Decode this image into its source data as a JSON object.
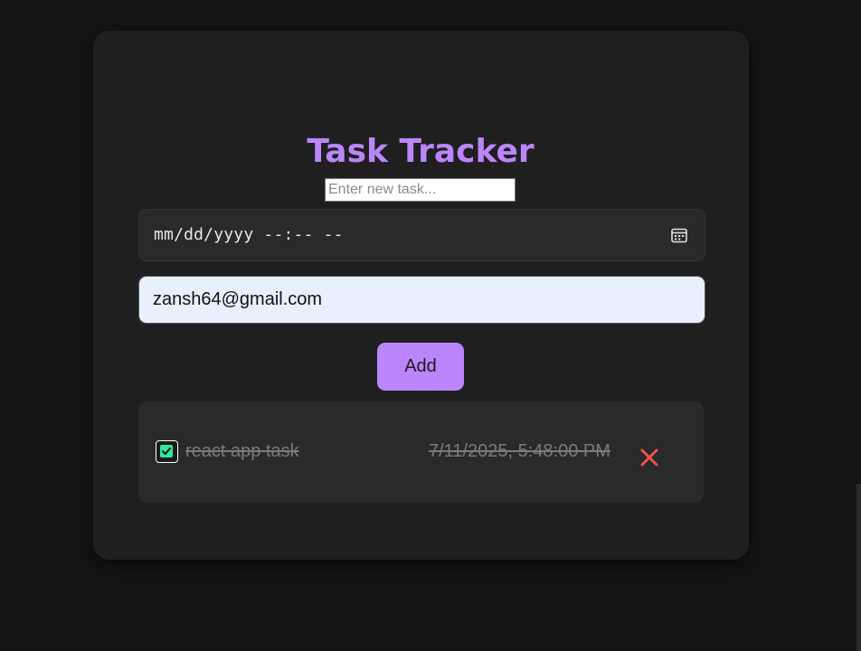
{
  "app": {
    "title": "Task Tracker"
  },
  "form": {
    "task_input": {
      "value": "",
      "placeholder": "Enter new task..."
    },
    "datetime_input": {
      "placeholder": "mm/dd/yyyy --:-- --"
    },
    "email_input": {
      "value": "zansh64@gmail.com"
    },
    "add_label": "Add"
  },
  "tasks": [
    {
      "text": "react app task",
      "date": "7/11/2025, 5:48:00 PM",
      "completed": true
    }
  ],
  "icons": {
    "calendar": "calendar-icon",
    "check": "checkbox-checked-icon",
    "delete": "close-icon"
  },
  "colors": {
    "accent": "#bb86fc",
    "check": "#2ee89a",
    "delete": "#ef5350",
    "card": "#1f1f1f",
    "background": "#141414"
  }
}
